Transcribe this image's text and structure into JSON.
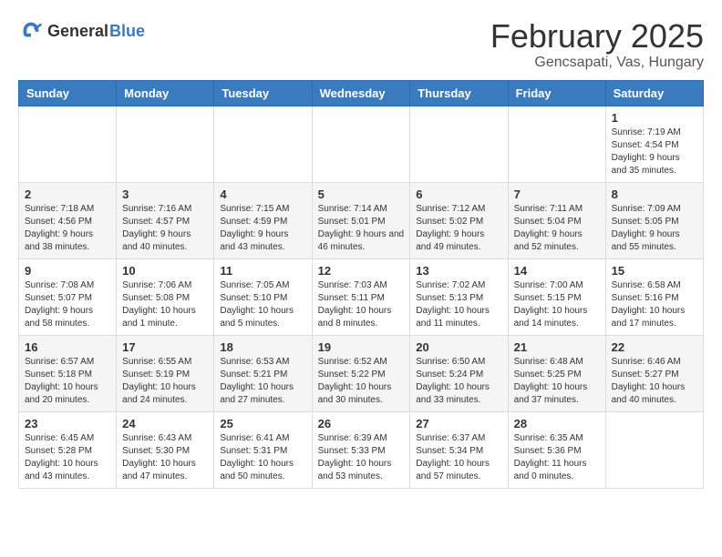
{
  "header": {
    "logo_general": "General",
    "logo_blue": "Blue",
    "title": "February 2025",
    "subtitle": "Gencsapati, Vas, Hungary"
  },
  "weekdays": [
    "Sunday",
    "Monday",
    "Tuesday",
    "Wednesday",
    "Thursday",
    "Friday",
    "Saturday"
  ],
  "weeks": [
    [
      {
        "day": "",
        "info": ""
      },
      {
        "day": "",
        "info": ""
      },
      {
        "day": "",
        "info": ""
      },
      {
        "day": "",
        "info": ""
      },
      {
        "day": "",
        "info": ""
      },
      {
        "day": "",
        "info": ""
      },
      {
        "day": "1",
        "info": "Sunrise: 7:19 AM\nSunset: 4:54 PM\nDaylight: 9 hours and 35 minutes."
      }
    ],
    [
      {
        "day": "2",
        "info": "Sunrise: 7:18 AM\nSunset: 4:56 PM\nDaylight: 9 hours and 38 minutes."
      },
      {
        "day": "3",
        "info": "Sunrise: 7:16 AM\nSunset: 4:57 PM\nDaylight: 9 hours and 40 minutes."
      },
      {
        "day": "4",
        "info": "Sunrise: 7:15 AM\nSunset: 4:59 PM\nDaylight: 9 hours and 43 minutes."
      },
      {
        "day": "5",
        "info": "Sunrise: 7:14 AM\nSunset: 5:01 PM\nDaylight: 9 hours and 46 minutes."
      },
      {
        "day": "6",
        "info": "Sunrise: 7:12 AM\nSunset: 5:02 PM\nDaylight: 9 hours and 49 minutes."
      },
      {
        "day": "7",
        "info": "Sunrise: 7:11 AM\nSunset: 5:04 PM\nDaylight: 9 hours and 52 minutes."
      },
      {
        "day": "8",
        "info": "Sunrise: 7:09 AM\nSunset: 5:05 PM\nDaylight: 9 hours and 55 minutes."
      }
    ],
    [
      {
        "day": "9",
        "info": "Sunrise: 7:08 AM\nSunset: 5:07 PM\nDaylight: 9 hours and 58 minutes."
      },
      {
        "day": "10",
        "info": "Sunrise: 7:06 AM\nSunset: 5:08 PM\nDaylight: 10 hours and 1 minute."
      },
      {
        "day": "11",
        "info": "Sunrise: 7:05 AM\nSunset: 5:10 PM\nDaylight: 10 hours and 5 minutes."
      },
      {
        "day": "12",
        "info": "Sunrise: 7:03 AM\nSunset: 5:11 PM\nDaylight: 10 hours and 8 minutes."
      },
      {
        "day": "13",
        "info": "Sunrise: 7:02 AM\nSunset: 5:13 PM\nDaylight: 10 hours and 11 minutes."
      },
      {
        "day": "14",
        "info": "Sunrise: 7:00 AM\nSunset: 5:15 PM\nDaylight: 10 hours and 14 minutes."
      },
      {
        "day": "15",
        "info": "Sunrise: 6:58 AM\nSunset: 5:16 PM\nDaylight: 10 hours and 17 minutes."
      }
    ],
    [
      {
        "day": "16",
        "info": "Sunrise: 6:57 AM\nSunset: 5:18 PM\nDaylight: 10 hours and 20 minutes."
      },
      {
        "day": "17",
        "info": "Sunrise: 6:55 AM\nSunset: 5:19 PM\nDaylight: 10 hours and 24 minutes."
      },
      {
        "day": "18",
        "info": "Sunrise: 6:53 AM\nSunset: 5:21 PM\nDaylight: 10 hours and 27 minutes."
      },
      {
        "day": "19",
        "info": "Sunrise: 6:52 AM\nSunset: 5:22 PM\nDaylight: 10 hours and 30 minutes."
      },
      {
        "day": "20",
        "info": "Sunrise: 6:50 AM\nSunset: 5:24 PM\nDaylight: 10 hours and 33 minutes."
      },
      {
        "day": "21",
        "info": "Sunrise: 6:48 AM\nSunset: 5:25 PM\nDaylight: 10 hours and 37 minutes."
      },
      {
        "day": "22",
        "info": "Sunrise: 6:46 AM\nSunset: 5:27 PM\nDaylight: 10 hours and 40 minutes."
      }
    ],
    [
      {
        "day": "23",
        "info": "Sunrise: 6:45 AM\nSunset: 5:28 PM\nDaylight: 10 hours and 43 minutes."
      },
      {
        "day": "24",
        "info": "Sunrise: 6:43 AM\nSunset: 5:30 PM\nDaylight: 10 hours and 47 minutes."
      },
      {
        "day": "25",
        "info": "Sunrise: 6:41 AM\nSunset: 5:31 PM\nDaylight: 10 hours and 50 minutes."
      },
      {
        "day": "26",
        "info": "Sunrise: 6:39 AM\nSunset: 5:33 PM\nDaylight: 10 hours and 53 minutes."
      },
      {
        "day": "27",
        "info": "Sunrise: 6:37 AM\nSunset: 5:34 PM\nDaylight: 10 hours and 57 minutes."
      },
      {
        "day": "28",
        "info": "Sunrise: 6:35 AM\nSunset: 5:36 PM\nDaylight: 11 hours and 0 minutes."
      },
      {
        "day": "",
        "info": ""
      }
    ]
  ]
}
